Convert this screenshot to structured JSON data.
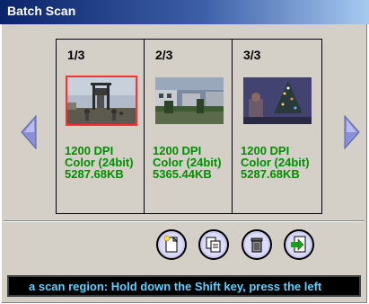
{
  "window": {
    "title": "Batch Scan"
  },
  "panels": [
    {
      "index_label": "1/3",
      "dpi": "1200 DPI",
      "color": "Color (24bit)",
      "size": "5287.68KB",
      "selected": true,
      "image": "kids-playground-photo"
    },
    {
      "index_label": "2/3",
      "dpi": "1200 DPI",
      "color": "Color (24bit)",
      "size": "5365.44KB",
      "selected": false,
      "image": "street-houses-photo"
    },
    {
      "index_label": "3/3",
      "dpi": "1200 DPI",
      "color": "Color (24bit)",
      "size": "5287.68KB",
      "selected": false,
      "image": "christmas-tree-photo"
    }
  ],
  "navigation": {
    "prev_icon": "triangle-left-icon",
    "next_icon": "triangle-right-icon"
  },
  "toolbar": [
    {
      "icon": "new-document-icon"
    },
    {
      "icon": "copy-icon"
    },
    {
      "icon": "trash-icon"
    },
    {
      "icon": "export-icon"
    }
  ],
  "status": {
    "text": "a scan region: Hold down the Shift key, press the left"
  },
  "colors": {
    "title_bar": "#0a246a",
    "info_text": "#008f00",
    "status_text": "#5fd0ff",
    "selection": "#ff3030",
    "arrow": "#8a90d8"
  }
}
